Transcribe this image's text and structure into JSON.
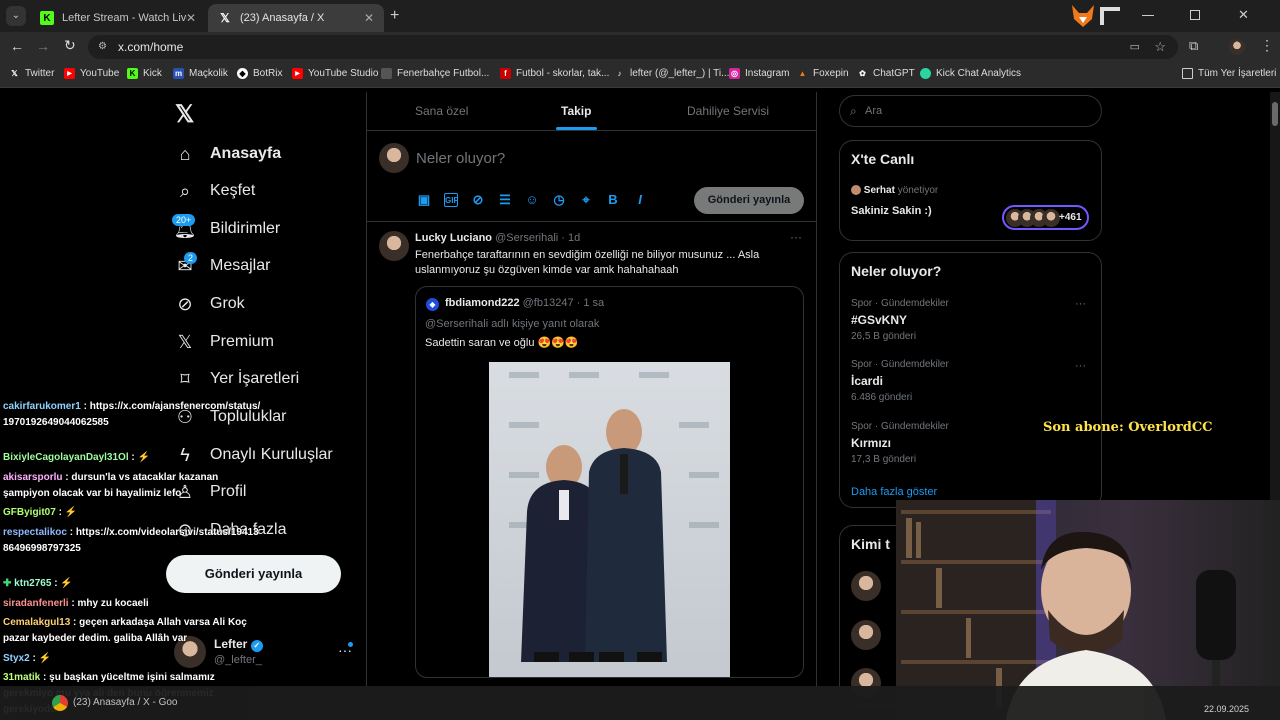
{
  "browser": {
    "tabs": [
      {
        "title": "Lefter Stream - Watch Live on K",
        "icon": "kick-icon"
      },
      {
        "title": "(23) Anasayfa / X",
        "icon": "x-icon"
      }
    ],
    "url": "x.com/home",
    "bookmarks": [
      "Twitter",
      "YouTube",
      "Kick",
      "Maçkolik",
      "BotRix",
      "YouTube Studio",
      "Fenerbahçe Futbol...",
      "Futbol - skorlar, tak...",
      "lefter (@_lefter_) | Ti...",
      "Instagram",
      "Foxepin",
      "ChatGPT",
      "Kick Chat Analytics"
    ],
    "all_bookmarks": "Tüm Yer İşaretleri"
  },
  "nav": {
    "items": [
      "Anasayfa",
      "Keşfet",
      "Bildirimler",
      "Mesajlar",
      "Grok",
      "Premium",
      "Yer İşaretleri",
      "Topluluklar",
      "Onaylı Kuruluşlar",
      "Profil",
      "Daha fazla"
    ],
    "notif_badge": "20+",
    "msg_badge": "2",
    "post_button": "Gönderi yayınla",
    "profile_name": "Lefter",
    "profile_handle": "@_lefter_"
  },
  "feed": {
    "tabs": [
      "Sana özel",
      "Takip",
      "Dahiliye Servisi"
    ],
    "compose_placeholder": "Neler oluyor?",
    "compose_button": "Gönderi yayınla",
    "tweet": {
      "name": "Lucky Luciano",
      "handle": "@Serserihali",
      "time": "· 1d",
      "text": "Fenerbahçe taraftarının en sevdiğim özelliği ne biliyor musunuz ... Asla uslanmıyoruz şu özgüven kimde var amk hahahahaah",
      "quote": {
        "name": "fbdiamond222",
        "handle": "@fb13247",
        "time": "· 1 sa",
        "reply_to": "@Serserihali adlı kişiye yanıt olarak",
        "text": "Sadettin saran ve oğlu 😍😍😍"
      }
    }
  },
  "sidebar": {
    "search_placeholder": "Ara",
    "live": {
      "title": "X'te Canlı",
      "host": "Serhat",
      "host_suffix": "yönetiyor",
      "space_title": "Sakiniz Sakin :)",
      "listeners": "+461"
    },
    "trends_title": "Neler oluyor?",
    "trends": [
      {
        "category": "Spor · Gündemdekiler",
        "name": "#GSvKNY",
        "count": "26,5 B gönderi"
      },
      {
        "category": "Spor · Gündemdekiler",
        "name": "İcardi",
        "count": "6.486 gönderi"
      },
      {
        "category": "Spor · Gündemdekiler",
        "name": "Kırmızı",
        "count": "17,3 B gönderi"
      }
    ],
    "show_more": "Daha fazla göster",
    "who_to_follow": "Kimi t"
  },
  "overlay": {
    "sub_label": "Son abone: OverlordCC",
    "chat": [
      {
        "user": "cakirfarukomer1",
        "color": "#8fd3ff",
        "msg": "https://x.com/ajansfenercom/status/1970192649044062585"
      },
      {
        "user": "BixiyleCagolayanDayl31Ol",
        "color": "#9dff9d",
        "msg": ""
      },
      {
        "user": "akisarsporlu",
        "color": "#ffb0ff",
        "msg": "dursun'la vs atacaklar kazanan şampiyon olacak var bi hayalimiz lefo"
      },
      {
        "user": "GFByigit07",
        "color": "#b0ff70",
        "msg": ""
      },
      {
        "user": "respectalikoc",
        "color": "#8fb8ff",
        "msg": "https://x.com/videolarsivi/status/1941386496998797325"
      },
      {
        "user": "ktn2765",
        "color": "#9dffd0",
        "msg": ""
      },
      {
        "user": "siradanfenerli",
        "color": "#ff9090",
        "msg": "mhy zu kocaeli"
      },
      {
        "user": "Cemalakgul13",
        "color": "#ffd070",
        "msg": "geçen arkadaşa Allah varsa Ali Koç pazar kaybeder dedim. galiba Allâh var"
      },
      {
        "user": "Styx2",
        "color": "#8fd3ff",
        "msg": ""
      },
      {
        "user": "31matik",
        "color": "#c0ff80",
        "msg": "şu başkan yüceltme işini salmamız gerekmiyo mu yya ali den bunu öğrenmemiz gerekiyodu"
      }
    ]
  },
  "taskbar": {
    "app": "(23) Anasayfa / X - Goo",
    "date": "22.09.2025"
  }
}
